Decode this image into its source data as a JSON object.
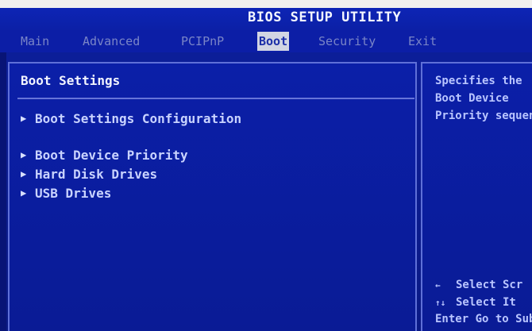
{
  "window": {
    "title": "BIOS SETUP UTILITY"
  },
  "tabs": [
    {
      "label": "Main",
      "active": false
    },
    {
      "label": "Advanced",
      "active": false
    },
    {
      "label": "PCIPnP",
      "active": false
    },
    {
      "label": "Boot",
      "active": true
    },
    {
      "label": "Security",
      "active": false
    },
    {
      "label": "Exit",
      "active": false
    }
  ],
  "main": {
    "section_title": "Boot Settings",
    "items": [
      {
        "label": "Boot Settings Configuration",
        "icon": "right-triangle-icon"
      },
      {
        "label": "Boot Device Priority",
        "icon": "right-triangle-icon"
      },
      {
        "label": "Hard Disk Drives",
        "icon": "right-triangle-icon"
      },
      {
        "label": "USB Drives",
        "icon": "right-triangle-icon"
      }
    ]
  },
  "help": {
    "lines": [
      "Specifies the",
      "Boot Device",
      "Priority sequen"
    ]
  },
  "keys": [
    {
      "symbol": "←",
      "text": "Select Scr"
    },
    {
      "symbol": "↑↓",
      "text": "Select It"
    },
    {
      "symbol": "",
      "text": "Enter Go to Sub"
    }
  ],
  "colors": {
    "background": "#0c1ea6",
    "active_tab_bg": "#d2d5e3",
    "text_bright": "#f2f4ff",
    "text_item": "#c9d3ff"
  }
}
